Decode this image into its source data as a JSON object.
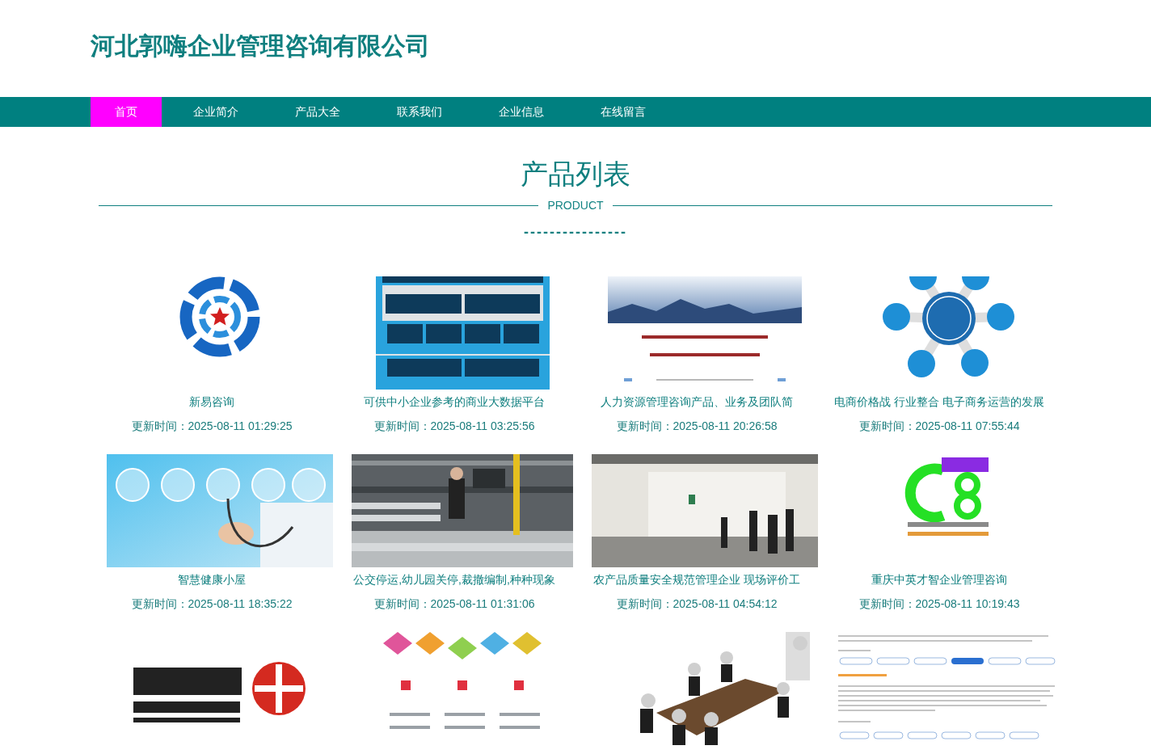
{
  "site_title": "河北郭嗨企业管理咨询有限公司",
  "nav": [
    {
      "label": "首页",
      "selected": true
    },
    {
      "label": "企业简介",
      "selected": false
    },
    {
      "label": "产品大全",
      "selected": false
    },
    {
      "label": "联系我们",
      "selected": false
    },
    {
      "label": "企业信息",
      "selected": false
    },
    {
      "label": "在线留言",
      "selected": false
    }
  ],
  "section": {
    "title": "产品列表",
    "subtitle": "PRODUCT",
    "divider": "----------------"
  },
  "products": [
    {
      "kind": "swirl",
      "title": "新易咨询",
      "updated": "更新时间：2025-08-11 01:29:25"
    },
    {
      "kind": "stack",
      "title": "可供中小企业参考的商业大数据平台",
      "updated": "更新时间：2025-08-11 03:25:56"
    },
    {
      "kind": "banner",
      "title": "人力资源管理咨询产品、业务及团队简",
      "updated": "更新时间：2025-08-11 20:26:58"
    },
    {
      "kind": "hub",
      "title": "电商价格战 行业整合 电子商务运营的发展",
      "updated": "更新时间：2025-08-11 07:55:44"
    },
    {
      "kind": "medical",
      "title": "智慧健康小屋",
      "updated": "更新时间：2025-08-11 18:35:22"
    },
    {
      "kind": "factory",
      "title": "公交停运,幼儿园关停,裁撤编制,种种现象",
      "updated": "更新时间：2025-08-11 01:31:06"
    },
    {
      "kind": "warehouse",
      "title": "农产品质量安全规范管理企业 现场评价工",
      "updated": "更新时间：2025-08-11 04:54:12"
    },
    {
      "kind": "monogram",
      "title": "重庆中英才智企业管理咨询",
      "updated": "更新时间：2025-08-11 10:19:43"
    },
    {
      "kind": "emblem"
    },
    {
      "kind": "flowchart"
    },
    {
      "kind": "meeting"
    },
    {
      "kind": "document"
    }
  ]
}
